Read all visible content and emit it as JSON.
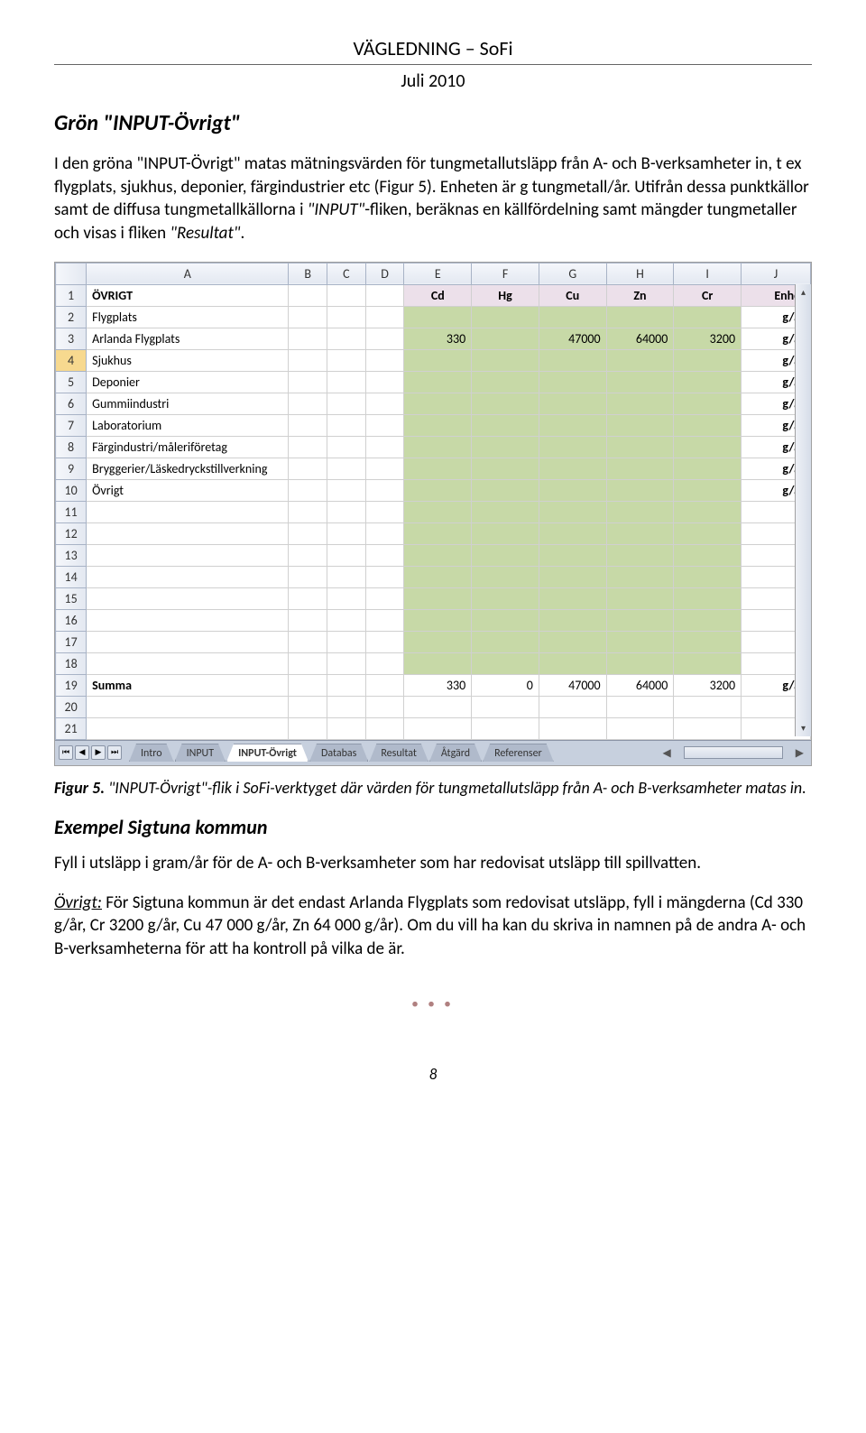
{
  "header": {
    "title": "VÄGLEDNING – SoFi",
    "date": "Juli 2010"
  },
  "section": {
    "title": "Grön \"INPUT-Övrigt\""
  },
  "paragraphs": {
    "p1a": "I den gröna \"INPUT-Övrigt\" matas mätningsvärden för tungmetallutsläpp från A- och B-verksamheter in, t ex flygplats, sjukhus, deponier, färgindustrier etc (Figur 5). Enheten är g tungmetall/år. Utifrån dessa punktkällor samt de diffusa tungmetallkällorna i ",
    "p1_em1": "\"INPUT\"",
    "p1b": "-fliken, beräknas en källfördelning samt mängder tungmetaller och visas i fliken ",
    "p1_em2": "\"Resultat\"",
    "p1c": "."
  },
  "caption": {
    "label": "Figur 5.",
    "text": " \"INPUT-Övrigt\"-flik i SoFi-verktyget där värden för tungmetallutsläpp från A- och B-verksamheter matas in."
  },
  "example": {
    "title": "Exempel Sigtuna kommun",
    "p1": "Fyll i utsläpp i gram/år för de A- och B-verksamheter som har redovisat utsläpp till spillvatten.",
    "p2_lead": "Övrigt:",
    "p2_text": " För Sigtuna kommun är det endast Arlanda Flygplats som redovisat utsläpp, fyll i mängderna (Cd 330 g/år, Cr 3200 g/år, Cu 47 000 g/år, Zn 64 000 g/år). Om du vill ha kan du skriva in namnen på de andra A- och B-verksamheterna för att ha kontroll på vilka de är."
  },
  "sheet": {
    "cols": [
      "A",
      "B",
      "C",
      "D",
      "E",
      "F",
      "G",
      "H",
      "I",
      "J"
    ],
    "header_metals": {
      "E": "Cd",
      "F": "Hg",
      "G": "Cu",
      "H": "Zn",
      "I": "Cr"
    },
    "enhet_label": "Enhet",
    "unit": "g/år",
    "rows": [
      {
        "n": 1,
        "A": "ÖVRIGT",
        "bold": true
      },
      {
        "n": 2,
        "A": "Flygplats"
      },
      {
        "n": 3,
        "A": "Arlanda Flygplats",
        "E": "330",
        "G": "47000",
        "H": "64000",
        "I": "3200"
      },
      {
        "n": 4,
        "A": "Sjukhus",
        "selected": true
      },
      {
        "n": 5,
        "A": "Deponier"
      },
      {
        "n": 6,
        "A": "Gummiindustri"
      },
      {
        "n": 7,
        "A": "Laboratorium"
      },
      {
        "n": 8,
        "A": "Färgindustri/måleriföretag"
      },
      {
        "n": 9,
        "A": "Bryggerier/Läskedryckstillverkning"
      },
      {
        "n": 10,
        "A": "Övrigt"
      },
      {
        "n": 11
      },
      {
        "n": 12
      },
      {
        "n": 13
      },
      {
        "n": 14
      },
      {
        "n": 15
      },
      {
        "n": 16
      },
      {
        "n": 17
      },
      {
        "n": 18
      },
      {
        "n": 19,
        "A": "Summa",
        "E": "330",
        "F": "0",
        "G": "47000",
        "H": "64000",
        "I": "3200",
        "sum": true
      },
      {
        "n": 20
      },
      {
        "n": 21
      }
    ],
    "tabs": [
      "Intro",
      "INPUT",
      "INPUT-Övrigt",
      "Databas",
      "Resultat",
      "Åtgärd",
      "Referenser"
    ],
    "active_tab": "INPUT-Övrigt"
  },
  "footer": {
    "dots": "● ● ●",
    "page": "8"
  }
}
